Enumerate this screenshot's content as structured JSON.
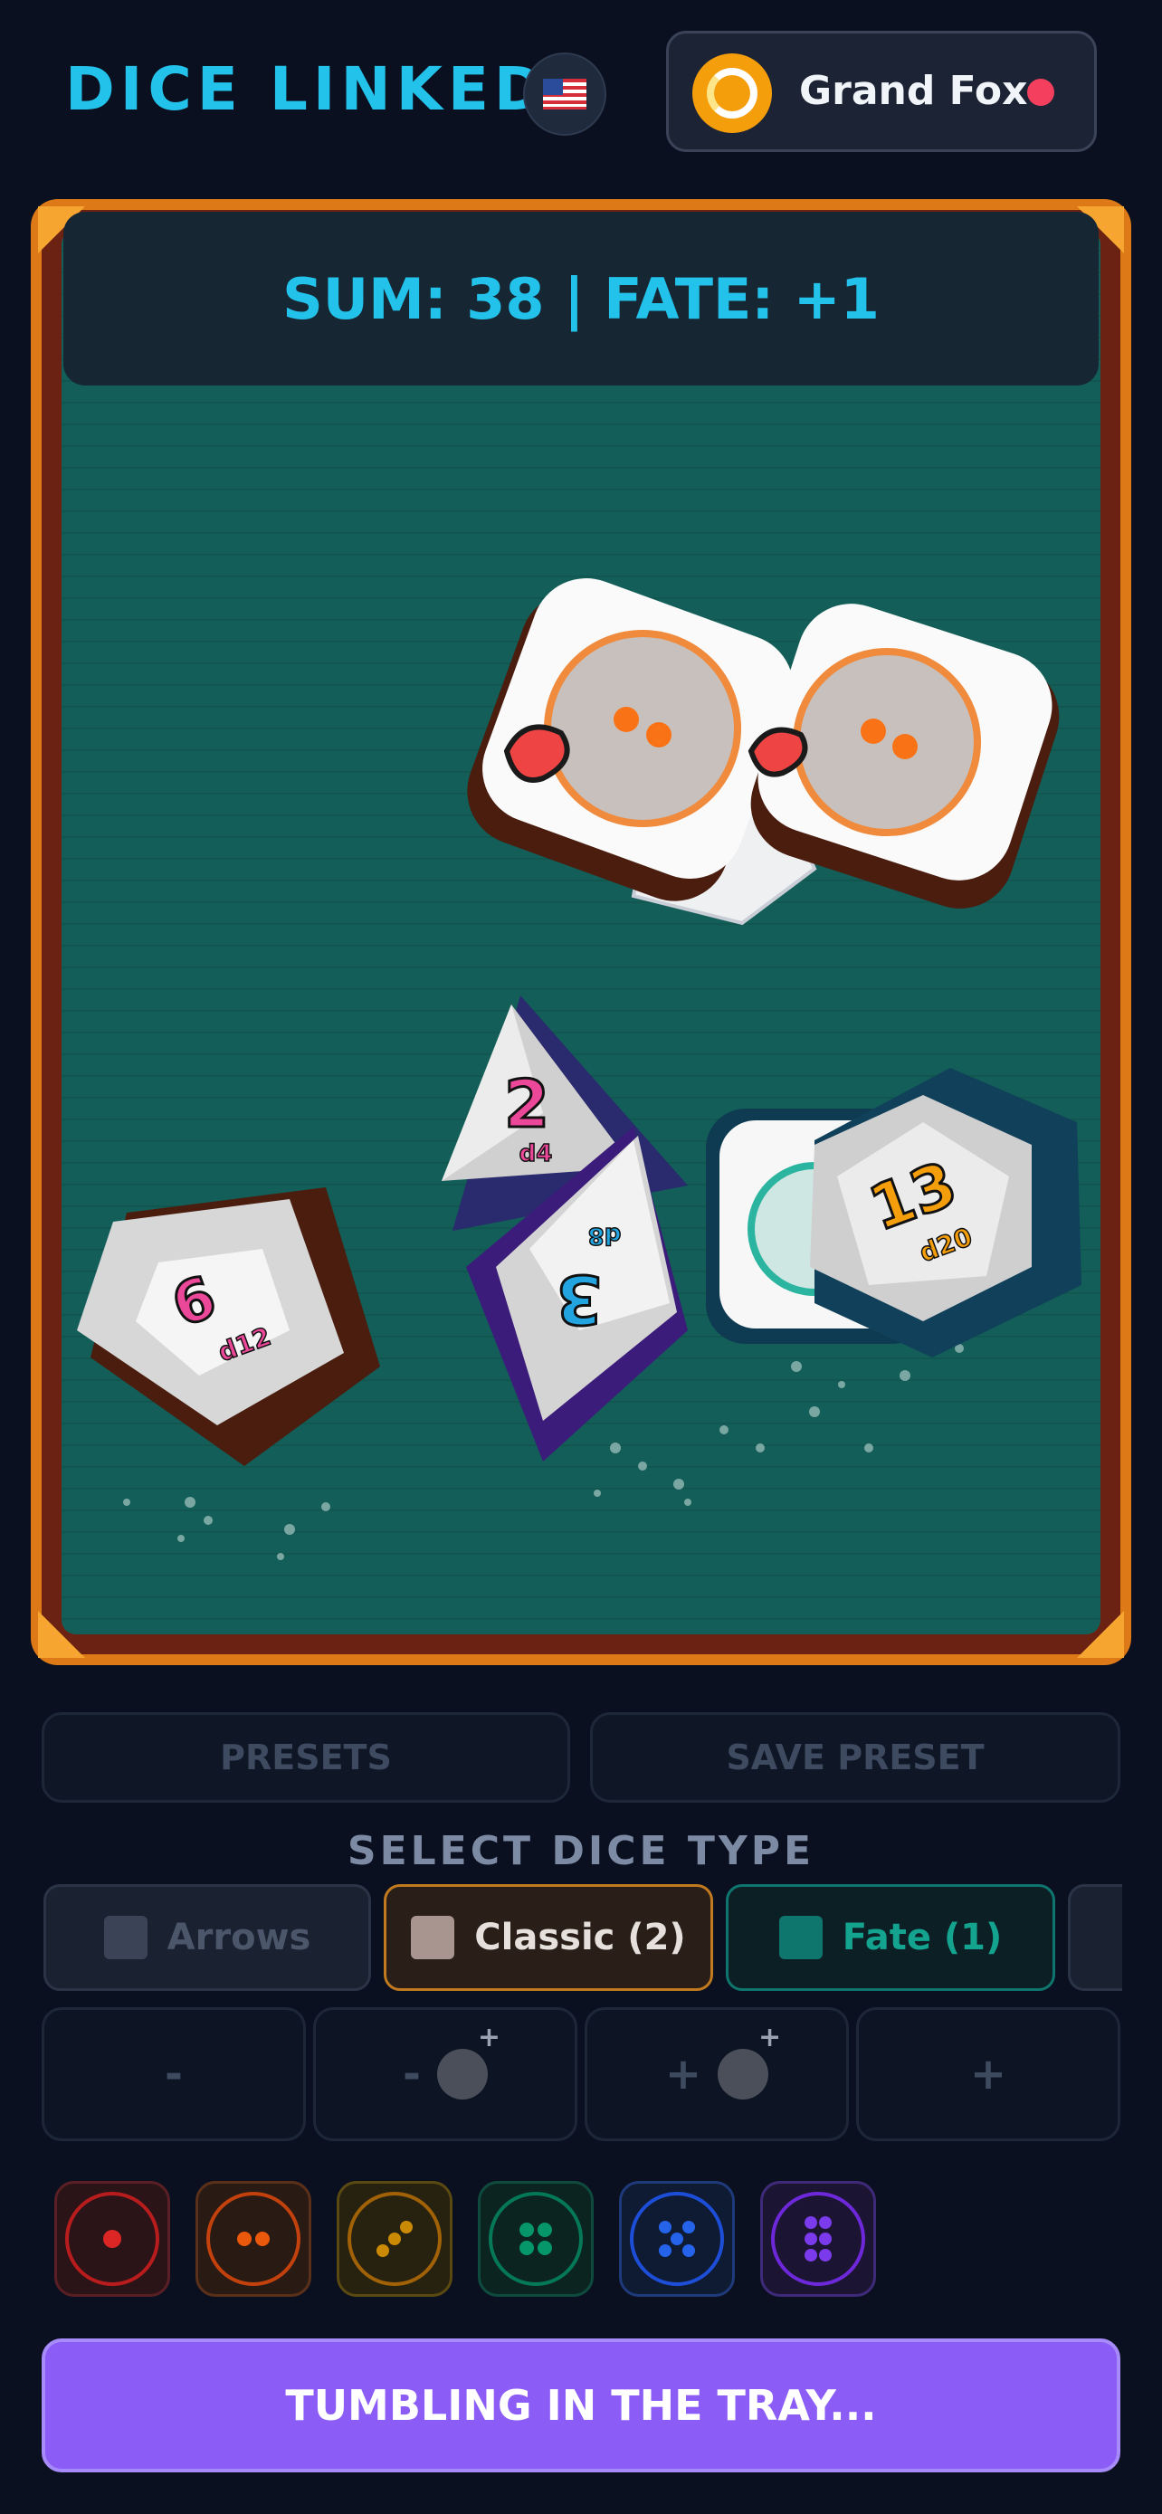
{
  "header": {
    "app_title": "DICE LINKED",
    "flag_icon": "us-flag-icon",
    "user": {
      "name": "Grand Fox",
      "status_color": "#f43f5e",
      "avatar_color": "#f59e0b"
    }
  },
  "tray": {
    "summary": "SUM: 38 | FATE: +1",
    "dice": [
      {
        "type": "d12",
        "value": "6"
      },
      {
        "type": "d4",
        "value": "2"
      },
      {
        "type": "d8",
        "value": "3"
      },
      {
        "type": "d20",
        "value": "13"
      }
    ]
  },
  "presets": {
    "presets_label": "PRESETS",
    "save_label": "SAVE PRESET"
  },
  "dice_type": {
    "heading": "SELECT DICE TYPE",
    "tabs": [
      {
        "label": "Arrows",
        "color": "#3b4457"
      },
      {
        "label": "Classic (2)",
        "color": "#a8958f"
      },
      {
        "label": "Fate (1)",
        "color": "#0f766e"
      }
    ]
  },
  "steppers": {
    "minus": "-",
    "minus_bomb": "-",
    "plus_bomb": "+",
    "plus": "+"
  },
  "pip_buttons": [
    {
      "name": "one",
      "color": "#dc2626"
    },
    {
      "name": "two",
      "color": "#ea580c"
    },
    {
      "name": "three",
      "color": "#ca8a04"
    },
    {
      "name": "four",
      "color": "#059669"
    },
    {
      "name": "five",
      "color": "#2563eb"
    },
    {
      "name": "six",
      "color": "#7c3aed"
    }
  ],
  "roll_button": {
    "label": "TUMBLING IN THE TRAY..."
  }
}
